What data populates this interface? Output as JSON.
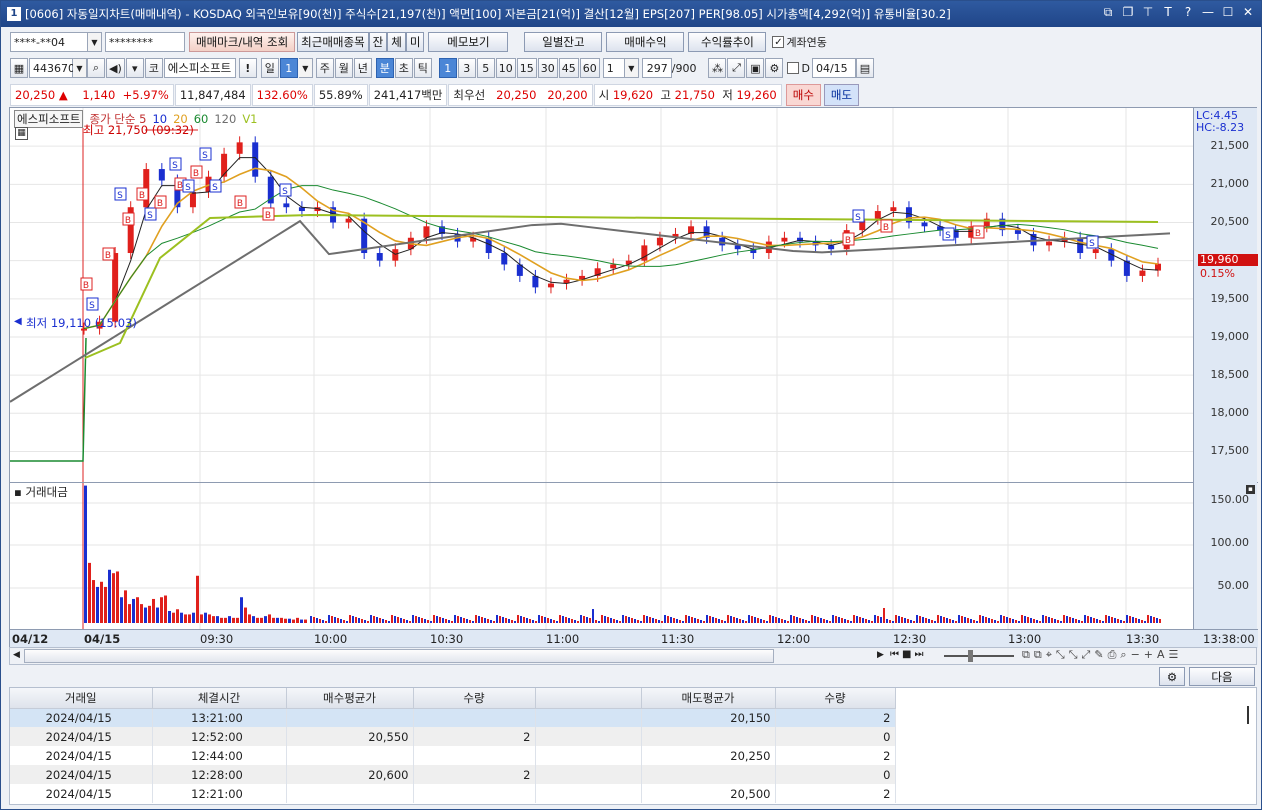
{
  "window": {
    "num": "1",
    "title": "[0606] 자동일지차트(매매내역) - KOSDAQ 외국인보유[90(천)] 주식수[21,197(천)] 액면[100] 자본금[21(억)] 결산[12월] EPS[207] PER[98.05] 시가총액[4,292(억)] 유통비율[30.2]"
  },
  "toolbar1": {
    "account": "****-**04",
    "password": "********",
    "mark_btn": "매매마크/내역 조회",
    "recent_btn": "최근매매종목",
    "jan": "잔",
    "che": "체",
    "mi": "미",
    "memo_btn": "메모보기",
    "daily_btn": "일별잔고",
    "profit_btn": "매매수익",
    "rate_btn": "수익률추이",
    "link_label": "계좌연동"
  },
  "toolbar2": {
    "code": "443670",
    "market": "코",
    "name": "에스피소프트",
    "excl": "!",
    "day": "일",
    "day_n": "1",
    "week": "주",
    "month": "월",
    "year": "년",
    "minute": "분",
    "sec": "초",
    "tick": "틱",
    "periods": [
      "1",
      "3",
      "5",
      "10",
      "15",
      "30",
      "45",
      "60"
    ],
    "period_n": "1",
    "count": "297",
    "count_max": "/900",
    "d_label": "D",
    "date": "04/15"
  },
  "quote": {
    "price": "20,250",
    "arrow": "▲",
    "change": "1,140",
    "change_pct": "+5.97%",
    "volume": "11,847,484",
    "vol_pct": "132.60%",
    "ratio": "55.89%",
    "amount": "241,417백만",
    "best_label": "최우선",
    "ask": "20,250",
    "bid": "20,200",
    "open_label": "시",
    "open": "19,620",
    "high_label": "고",
    "high": "21,750",
    "low_label": "저",
    "low": "19,260",
    "buy_btn": "매수",
    "sell_btn": "매도"
  },
  "chart": {
    "legend_name": "에스피소프트",
    "legend_ma": "종가 단순 5",
    "ma_periods": [
      "10",
      "20",
      "60",
      "120",
      "V1"
    ],
    "lc": "LC:4.45",
    "hc": "HC:-8.23",
    "high_note": "최고 21,750 (09:32)",
    "low_note": "최저 19,110 (15:03)",
    "cur_price": "19,960",
    "cur_pct": "0.15%",
    "vol_title": "거래대금",
    "colors": {
      "up": "#e0201c",
      "down": "#1a2fd0",
      "ma5": "#222222",
      "ma10": "#1a2fd0",
      "ma20": "#e0a020",
      "ma60": "#1a8a30",
      "ma120": "#6e6e6e",
      "v1": "#9cc020"
    }
  },
  "chart_data": {
    "type": "line",
    "title": "",
    "price_ticks": [
      "21,500",
      "21,000",
      "20,500",
      "20,000",
      "19,500",
      "19,000",
      "18,500",
      "18,000",
      "17,500"
    ],
    "vol_ticks": [
      "150.00",
      "100.00",
      "50.00"
    ],
    "x_ticks": [
      "04/12",
      "04/15",
      "09:30",
      "10:00",
      "10:30",
      "11:00",
      "11:30",
      "12:00",
      "12:30",
      "13:00",
      "13:30"
    ],
    "x_time_end": "13:38:00",
    "ylim": [
      17100,
      22000
    ],
    "series": [
      {
        "values": [
          19110,
          19200,
          20100,
          20700,
          21200,
          21050,
          20700,
          20900,
          21100,
          21400,
          21550,
          21100,
          20750,
          20700,
          20650,
          20700,
          20500,
          20550,
          20100,
          20000,
          20150,
          20300,
          20450,
          20350,
          20250,
          20300,
          20100,
          19950,
          19800,
          19650,
          19700,
          19750,
          19800,
          19900,
          19950,
          20000,
          20200,
          20300,
          20350,
          20450,
          20300,
          20200,
          20150,
          20100,
          20250,
          20300,
          20250,
          20200,
          20150,
          20400,
          20550,
          20650,
          20700,
          20500,
          20450,
          20400,
          20300,
          20450,
          20550,
          20400,
          20350,
          20200,
          20250,
          20300,
          20100,
          20150,
          20000,
          19800,
          19870,
          19960
        ]
      }
    ]
  },
  "table": {
    "headers": [
      "거래일",
      "체결시간",
      "매수평균가",
      "수량",
      "",
      "매도평균가",
      "수량"
    ],
    "rows": [
      [
        "2024/04/15",
        "13:21:00",
        "",
        "",
        "",
        "20,150",
        "2"
      ],
      [
        "2024/04/15",
        "12:52:00",
        "20,550",
        "2",
        "",
        "",
        "0"
      ],
      [
        "2024/04/15",
        "12:44:00",
        "",
        "",
        "",
        "20,250",
        "2"
      ],
      [
        "2024/04/15",
        "12:28:00",
        "20,600",
        "2",
        "",
        "",
        "0"
      ],
      [
        "2024/04/15",
        "12:21:00",
        "",
        "",
        "",
        "20,500",
        "2"
      ]
    ],
    "next_btn": "다음"
  }
}
